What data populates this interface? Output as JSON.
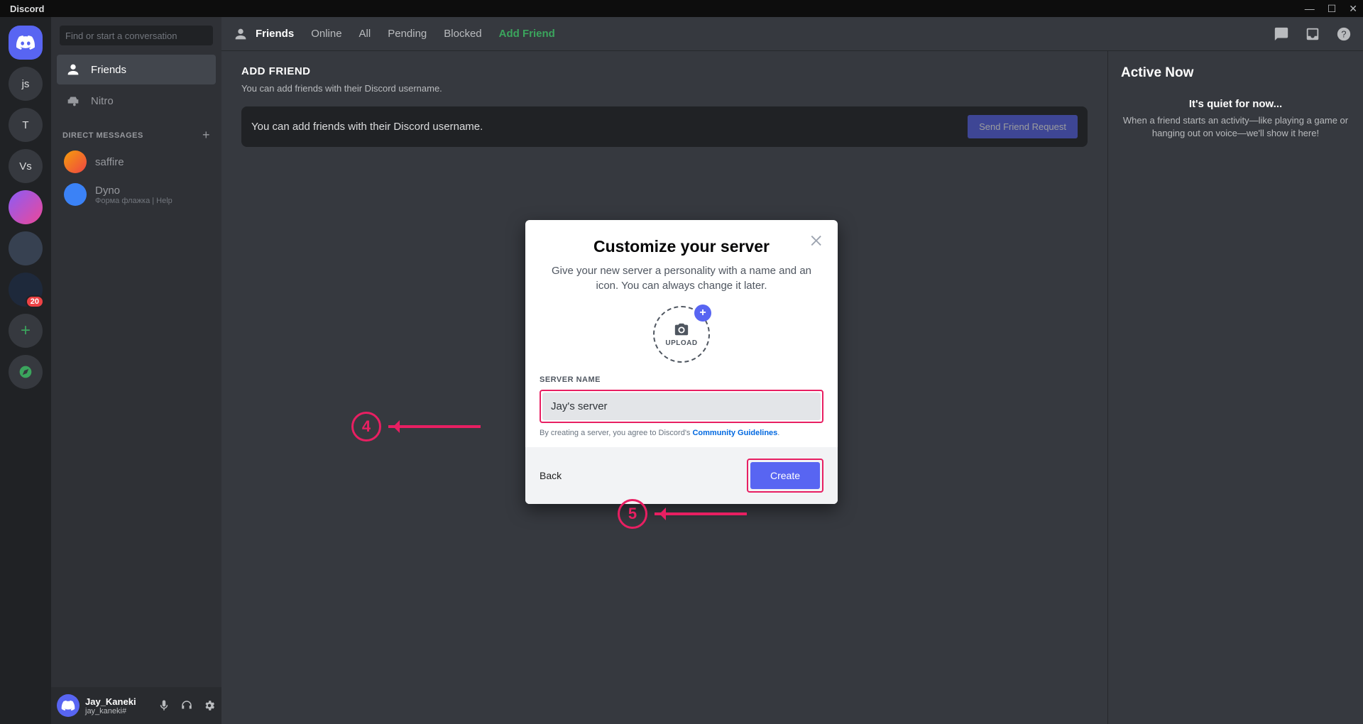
{
  "titlebar": {
    "app_name": "Discord"
  },
  "server_rail": {
    "pills": [
      {
        "label": "js"
      },
      {
        "label": "T"
      },
      {
        "label": "Vs"
      }
    ],
    "badge_count": "20"
  },
  "sidebar": {
    "search_placeholder": "Find or start a conversation",
    "friends_label": "Friends",
    "nitro_label": "Nitro",
    "dm_header": "DIRECT MESSAGES",
    "dms": [
      {
        "name": "saffire",
        "sub": ""
      },
      {
        "name": "Dyno",
        "sub": "Форма флажка | Help"
      }
    ]
  },
  "user_panel": {
    "name": "Jay_Kaneki",
    "tag": "jay_kaneki#"
  },
  "topbar": {
    "friends": "Friends",
    "tabs": {
      "online": "Online",
      "all": "All",
      "pending": "Pending",
      "blocked": "Blocked",
      "add": "Add Friend"
    }
  },
  "add_friend": {
    "title": "ADD FRIEND",
    "subtitle": "You can add friends with their Discord username.",
    "placeholder": "You can add friends with their Discord username.",
    "button": "Send Friend Request"
  },
  "active_now": {
    "title": "Active Now",
    "quiet": "It's quiet for now...",
    "desc": "When a friend starts an activity—like playing a game or hanging out on voice—we'll show it here!"
  },
  "modal": {
    "title": "Customize your server",
    "subtitle": "Give your new server a personality with a name and an icon. You can always change it later.",
    "upload_label": "UPLOAD",
    "field_label": "SERVER NAME",
    "server_name_value": "Jay's server",
    "agree_prefix": "By creating a server, you agree to Discord's ",
    "agree_link": "Community Guidelines",
    "agree_suffix": ".",
    "back": "Back",
    "create": "Create"
  },
  "annotations": {
    "step4": "4",
    "step5": "5"
  }
}
